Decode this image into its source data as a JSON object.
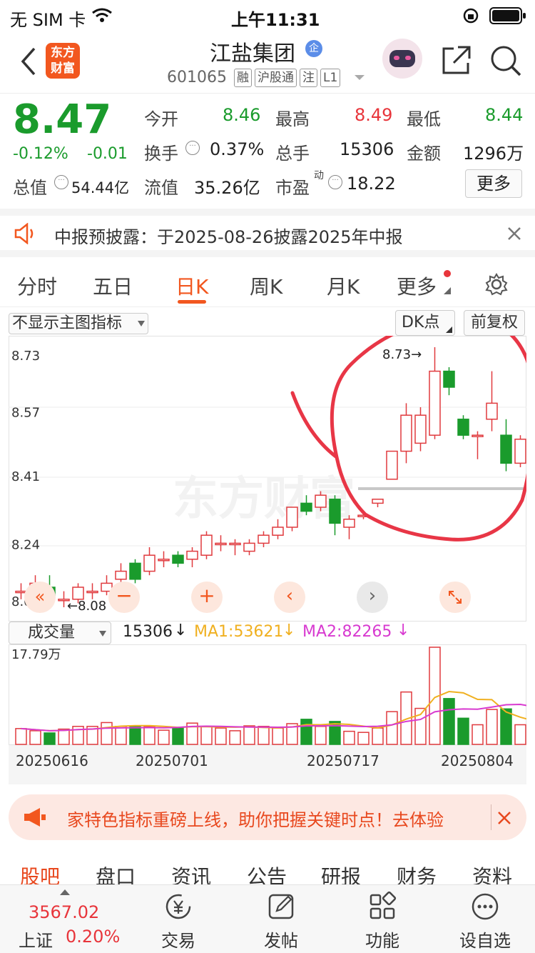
{
  "status_bar": {
    "carrier": "无 SIM 卡",
    "time": "上午11:31"
  },
  "header": {
    "logo_text_1": "东方",
    "logo_text_2": "财富",
    "stock_name": "江盐集团",
    "badge": "企",
    "code": "601065",
    "tags": [
      "融",
      "沪股通",
      "注",
      "L1"
    ]
  },
  "quote": {
    "price": "8.47",
    "change_pct": "-0.12%",
    "change_abs": "-0.01",
    "stats": [
      {
        "label": "今开",
        "value": "8.46",
        "color": "#1a9b2c"
      },
      {
        "label": "最高",
        "value": "8.49",
        "color": "#e8353b"
      },
      {
        "label": "最低",
        "value": "8.44",
        "color": "#1a9b2c"
      },
      {
        "label": "换手",
        "value": "0.37%",
        "color": "#222"
      },
      {
        "label": "总手",
        "value": "15306",
        "color": "#222"
      },
      {
        "label": "金额",
        "value": "1296万",
        "color": "#222"
      }
    ],
    "total_value_label": "总值",
    "total_value": "54.44亿",
    "float_value_label": "流值",
    "float_value": "35.26亿",
    "pe_label": "市盈",
    "pe_sup": "动",
    "pe_value": "18.22",
    "more_button": "更多"
  },
  "notice": {
    "text": "中报预披露：于2025-08-26披露2025年中报"
  },
  "tabs": {
    "items": [
      "分时",
      "五日",
      "日K",
      "周K",
      "月K",
      "更多"
    ],
    "active": "日K"
  },
  "chart": {
    "indicator_select": "不显示主图指标",
    "dk_button": "DK点",
    "adjust_button": "前复权",
    "watermark": "东方财富",
    "max_label": "8.73→",
    "min_label": "←8.08"
  },
  "chart_data": {
    "type": "candlestick",
    "y_ticks": [
      "8.73",
      "8.57",
      "8.41",
      "8.24",
      "8.08"
    ],
    "ylim": [
      8.08,
      8.73
    ],
    "candles": [
      [
        8.12,
        8.12,
        8.14,
        8.1
      ],
      [
        8.11,
        8.14,
        8.16,
        8.1
      ],
      [
        8.13,
        8.11,
        8.16,
        8.09
      ],
      [
        8.1,
        8.1,
        8.12,
        8.08
      ],
      [
        8.1,
        8.13,
        8.14,
        8.09
      ],
      [
        8.12,
        8.12,
        8.14,
        8.1
      ],
      [
        8.12,
        8.14,
        8.16,
        8.11
      ],
      [
        8.15,
        8.17,
        8.19,
        8.14
      ],
      [
        8.19,
        8.15,
        8.2,
        8.14
      ],
      [
        8.17,
        8.21,
        8.23,
        8.16
      ],
      [
        8.2,
        8.2,
        8.22,
        8.18
      ],
      [
        8.21,
        8.19,
        8.22,
        8.18
      ],
      [
        8.2,
        8.22,
        8.23,
        8.18
      ],
      [
        8.21,
        8.26,
        8.27,
        8.2
      ],
      [
        8.24,
        8.24,
        8.26,
        8.22
      ],
      [
        8.24,
        8.24,
        8.25,
        8.21
      ],
      [
        8.22,
        8.24,
        8.25,
        8.21
      ],
      [
        8.24,
        8.26,
        8.27,
        8.23
      ],
      [
        8.26,
        8.28,
        8.3,
        8.25
      ],
      [
        8.28,
        8.33,
        8.33,
        8.27
      ],
      [
        8.34,
        8.32,
        8.36,
        8.31
      ],
      [
        8.33,
        8.36,
        8.37,
        8.32
      ],
      [
        8.35,
        8.29,
        8.36,
        8.26
      ],
      [
        8.28,
        8.3,
        8.31,
        8.25
      ],
      [
        8.31,
        8.31,
        8.32,
        8.3
      ],
      [
        8.34,
        8.35,
        8.35,
        8.33
      ],
      [
        8.4,
        8.47,
        8.47,
        8.4
      ],
      [
        8.47,
        8.56,
        8.59,
        8.44
      ],
      [
        8.49,
        8.56,
        8.58,
        8.47
      ],
      [
        8.51,
        8.67,
        8.73,
        8.5
      ],
      [
        8.67,
        8.63,
        8.68,
        8.61
      ],
      [
        8.55,
        8.51,
        8.56,
        8.5
      ],
      [
        8.51,
        8.51,
        8.52,
        8.45
      ],
      [
        8.55,
        8.59,
        8.67,
        8.52
      ],
      [
        8.51,
        8.44,
        8.55,
        8.42
      ],
      [
        8.44,
        8.5,
        8.51,
        8.43
      ],
      [
        8.48,
        8.5,
        8.51,
        8.47
      ]
    ],
    "x_labels": [
      "20250616",
      "20250701",
      "20250717",
      "20250804"
    ]
  },
  "volume": {
    "selector": "成交量",
    "total": "15306",
    "ma1": "MA1:53621",
    "ma2": "MA2:82265",
    "max_label": "17.79万",
    "values": [
      29,
      25,
      21,
      28,
      33,
      33,
      40,
      33,
      33,
      33,
      26,
      31,
      39,
      33,
      30,
      25,
      34,
      33,
      30,
      38,
      46,
      33,
      42,
      24,
      22,
      30,
      60,
      96,
      66,
      178,
      84,
      48,
      36,
      64,
      65,
      36,
      13
    ]
  },
  "promo": {
    "text": "家特色指标重磅上线，助你把握关键时点！去体验"
  },
  "func_tabs": [
    "股吧",
    "盘口",
    "资讯",
    "公告",
    "研报",
    "财务",
    "资料"
  ],
  "bottom": {
    "index_value": "3567.02",
    "index_name": "上证",
    "index_change": "0.20%",
    "items": [
      "交易",
      "发帖",
      "功能",
      "设自选"
    ]
  }
}
